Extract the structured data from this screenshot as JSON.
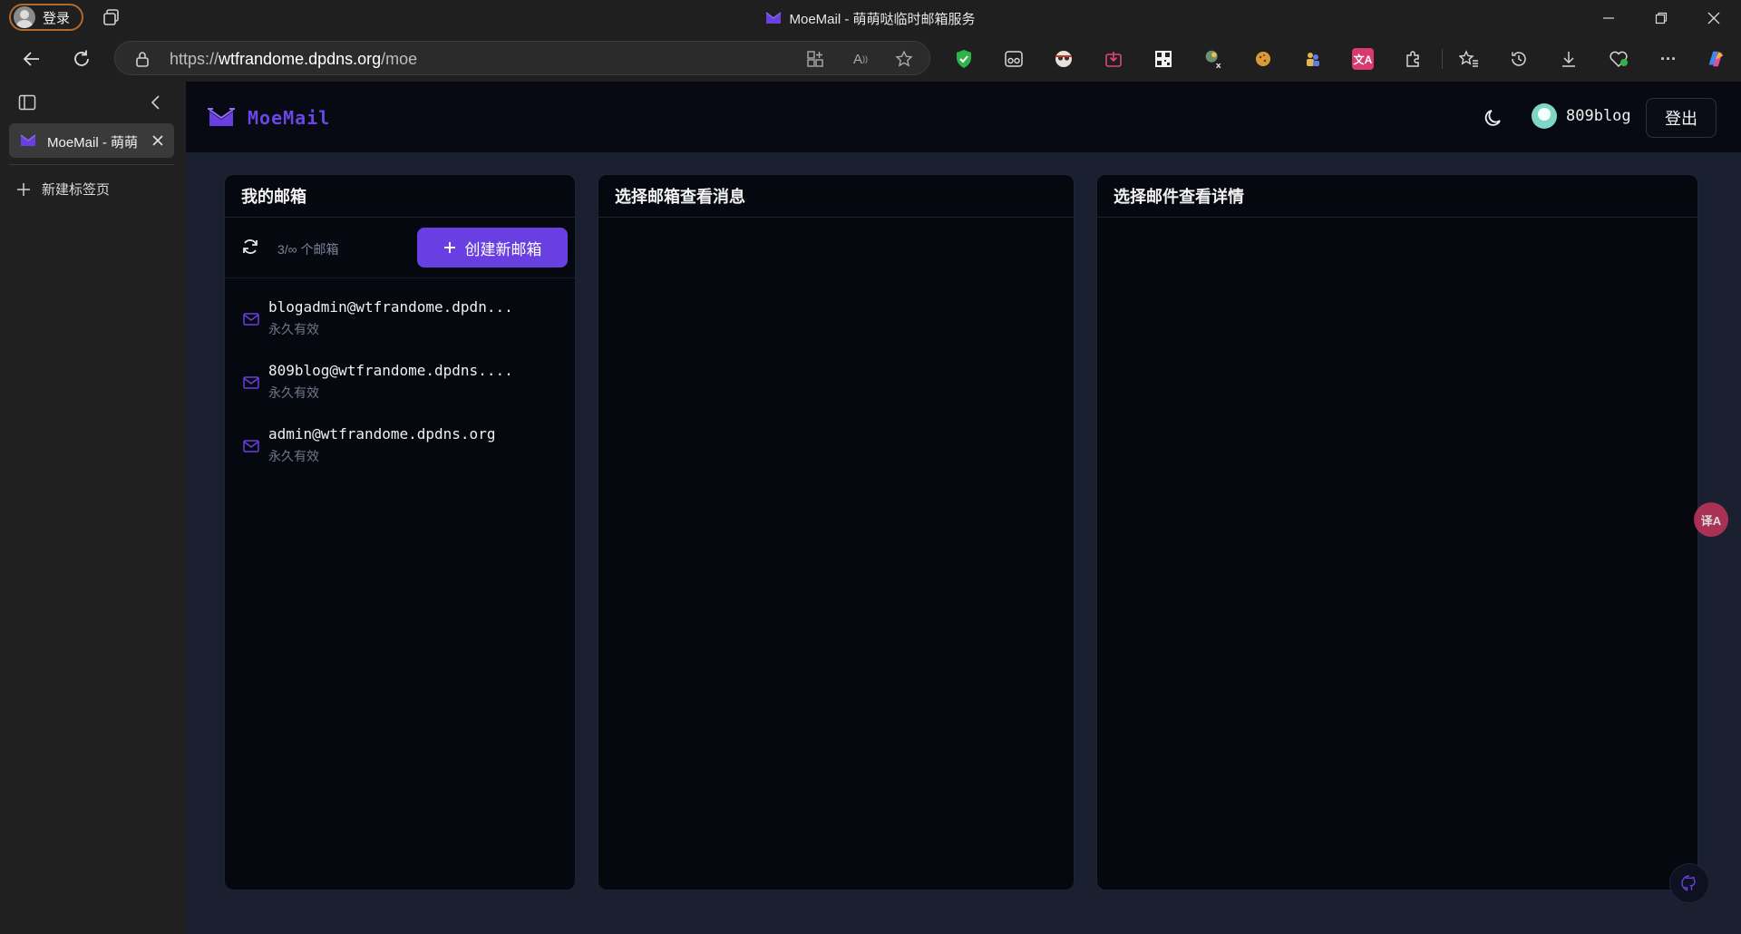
{
  "browser": {
    "profile_label": "登录",
    "window_title": "MoeMail - 萌萌哒临时邮箱服务",
    "url_prefix": "https://",
    "url_host": "wtfrandome.dpdns.org",
    "url_path": "/moe",
    "tab_title": "MoeMail - 萌萌",
    "new_tab_label": "新建标签页"
  },
  "app": {
    "logo_text": "MoeMail",
    "user_name": "809blog",
    "logout_label": "登出",
    "panels": {
      "mailboxes_title": "我的邮箱",
      "messages_title": "选择邮箱查看消息",
      "detail_title": "选择邮件查看详情"
    },
    "quota_text": "3/∞ 个邮箱",
    "create_label": "创建新邮箱",
    "mailboxes": [
      {
        "address": "blogadmin@wtfrandome.dpdn...",
        "expiry": "永久有效"
      },
      {
        "address": "809blog@wtfrandome.dpdns....",
        "expiry": "永久有效"
      },
      {
        "address": "admin@wtfrandome.dpdns.org",
        "expiry": "永久有效"
      }
    ]
  },
  "colors": {
    "accent": "#6a3fe2",
    "logo": "#6c45e6",
    "page_bg": "#1a2030",
    "panel_bg": "#06080f"
  }
}
